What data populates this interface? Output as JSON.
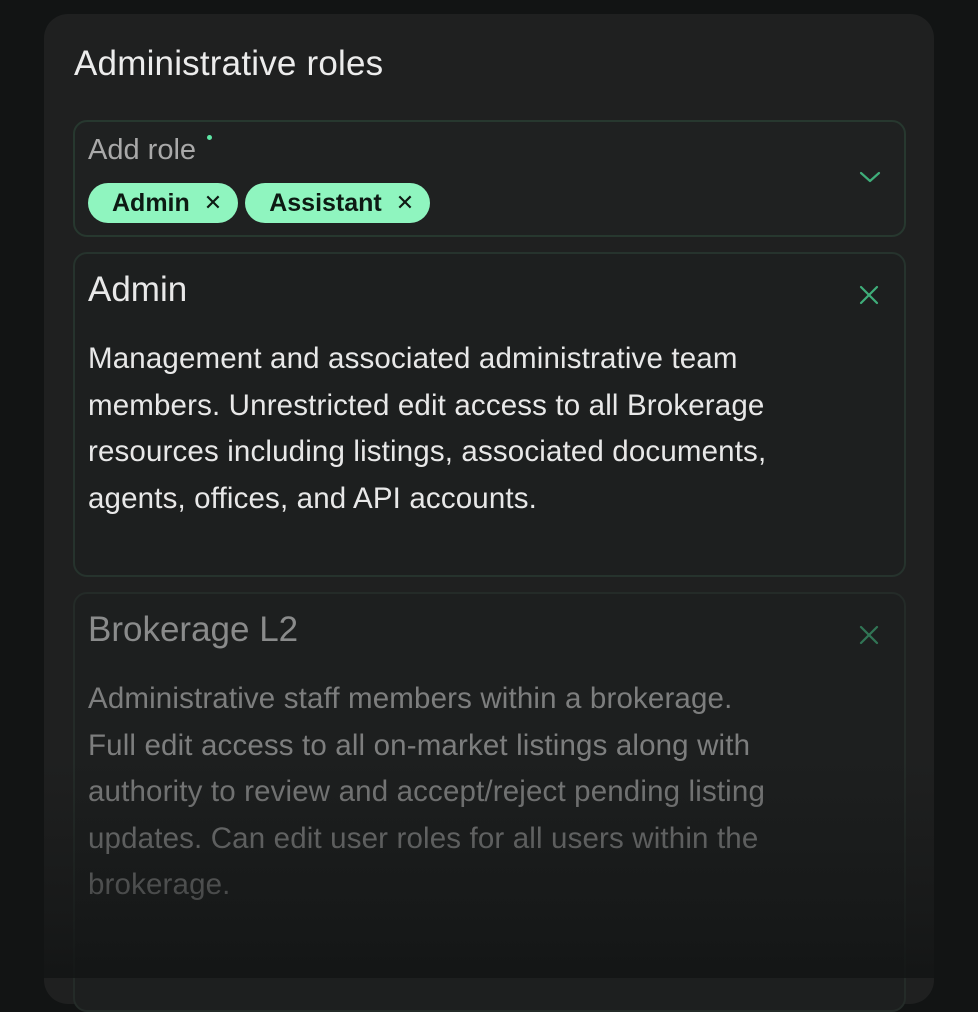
{
  "panel": {
    "title": "Administrative roles"
  },
  "role_select": {
    "label": "Add role",
    "selected_chips": [
      {
        "label": "Admin",
        "remove_icon": "close-icon"
      },
      {
        "label": "Assistant",
        "remove_icon": "close-icon"
      }
    ],
    "toggle_icon": "chevron-down-icon"
  },
  "role_cards": [
    {
      "title": "Admin",
      "description": "Management and associated administrative team members. Unrestricted edit access to all Brokerage resources including listings, associated documents, agents, offices, and API accounts.",
      "remove_icon": "close-icon"
    },
    {
      "title": "Brokerage L2",
      "description": "Administrative staff members within a brokerage. Full edit access to all on-market listings along with authority to review and accept/reject pending listing updates. Can edit user roles for all users within the brokerage.",
      "remove_icon": "close-icon"
    }
  ],
  "colors": {
    "background": "#121414",
    "panel": "#1f2020",
    "accent": "#8ff5bf",
    "accent_icon": "#3fae7a",
    "border": "#27382f"
  }
}
